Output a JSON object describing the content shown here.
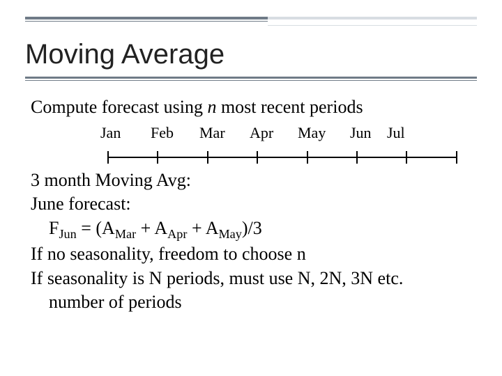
{
  "title": "Moving Average",
  "intro": {
    "pre": "Compute forecast using ",
    "n": "n",
    "post": " most recent periods"
  },
  "months": [
    "Jan",
    "Feb",
    "Mar",
    "Apr",
    "May",
    "Jun",
    "Jul"
  ],
  "lines": {
    "l1": "3 month Moving Avg:",
    "l2": "June forecast:",
    "formula": {
      "f_lead": "F",
      "f_sub": "Jun",
      "eq": " = (A",
      "a1_sub": "Mar",
      "plus1": " + A",
      "a2_sub": "Apr",
      "plus2": " + A",
      "a3_sub": "May",
      "tail": ")/3"
    },
    "l4": "If no seasonality, freedom to choose n",
    "l5": "If seasonality is N periods, must use N, 2N, 3N etc.",
    "l6": "number of periods"
  }
}
